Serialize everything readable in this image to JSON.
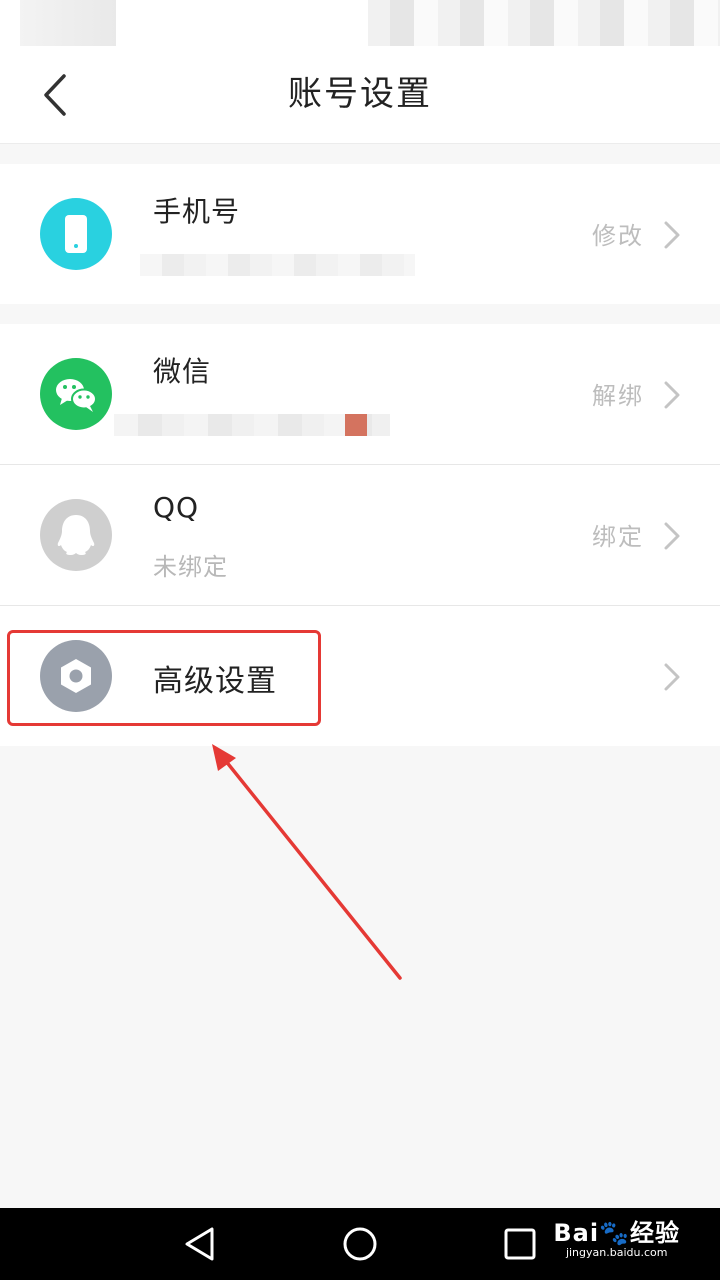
{
  "header": {
    "title": "账号设置"
  },
  "rows": {
    "phone": {
      "label": "手机号",
      "action": "修改"
    },
    "wechat": {
      "label": "微信",
      "action": "解绑"
    },
    "qq": {
      "label": "QQ",
      "sub": "未绑定",
      "action": "绑定"
    },
    "advanced": {
      "label": "高级设置"
    }
  },
  "watermark": {
    "brand": "Bai🐾经验",
    "url": "jingyan.baidu.com"
  },
  "colors": {
    "phone_icon": "#29d1e0",
    "wechat_icon": "#23c160",
    "qq_icon": "#cfcfcf",
    "advanced_icon": "#9aa1ac",
    "annotation": "#e53935"
  },
  "icons": {
    "back": "chevron-left-icon",
    "phone": "phone-icon",
    "wechat": "wechat-icon",
    "qq": "qq-icon",
    "advanced": "hexagon-settings-icon",
    "nav_back": "triangle-back-icon",
    "nav_home": "circle-home-icon",
    "nav_recent": "square-recents-icon"
  }
}
